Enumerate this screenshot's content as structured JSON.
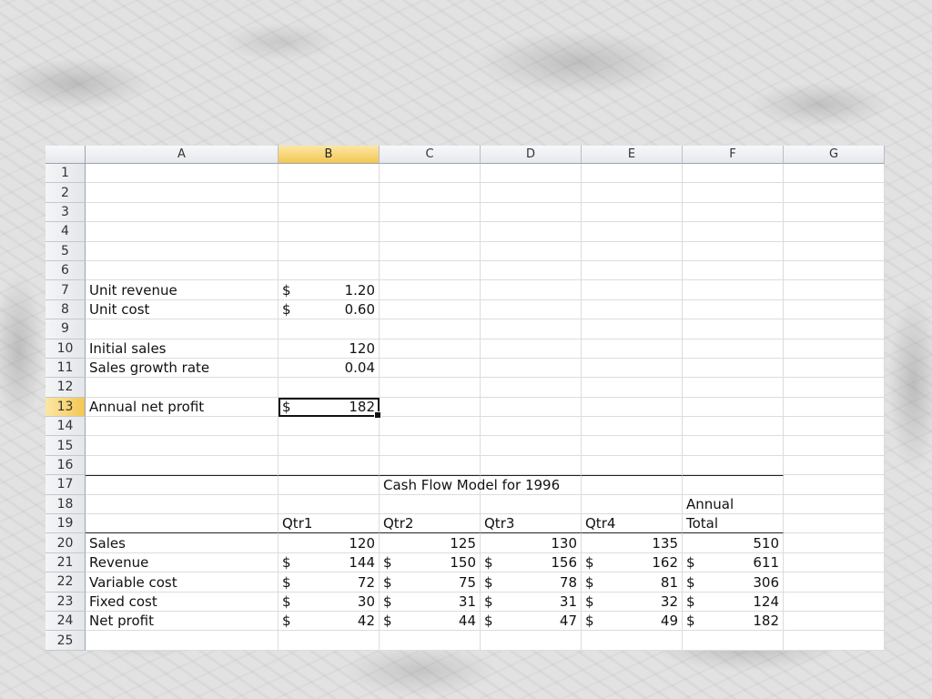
{
  "columns": [
    "A",
    "B",
    "C",
    "D",
    "E",
    "F",
    "G"
  ],
  "selected_column": "B",
  "selected_row": 13,
  "rows": 25,
  "currency_symbol": "$",
  "inputs": {
    "unit_revenue": {
      "label": "Unit revenue",
      "value": "1.20"
    },
    "unit_cost": {
      "label": "Unit cost",
      "value": "0.60"
    },
    "initial_sales": {
      "label": "Initial sales",
      "value": "120"
    },
    "sales_growth_rate": {
      "label": "Sales growth rate",
      "value": "0.04"
    },
    "annual_net_profit": {
      "label": "Annual net profit",
      "value": "182"
    }
  },
  "model": {
    "title": "Cash Flow Model for 1996",
    "annual_header_1": "Annual",
    "annual_header_2": "Total",
    "quarters": [
      "Qtr1",
      "Qtr2",
      "Qtr3",
      "Qtr4"
    ],
    "lines": [
      {
        "label": "Sales",
        "currency": false,
        "values": [
          "120",
          "125",
          "130",
          "135",
          "510"
        ]
      },
      {
        "label": "Revenue",
        "currency": true,
        "values": [
          "144",
          "150",
          "156",
          "162",
          "611"
        ]
      },
      {
        "label": "Variable cost",
        "currency": true,
        "values": [
          "72",
          "75",
          "78",
          "81",
          "306"
        ]
      },
      {
        "label": "Fixed cost",
        "currency": true,
        "values": [
          "30",
          "31",
          "31",
          "32",
          "124"
        ]
      },
      {
        "label": "Net profit",
        "currency": true,
        "values": [
          "42",
          "44",
          "47",
          "49",
          "182"
        ]
      }
    ]
  }
}
